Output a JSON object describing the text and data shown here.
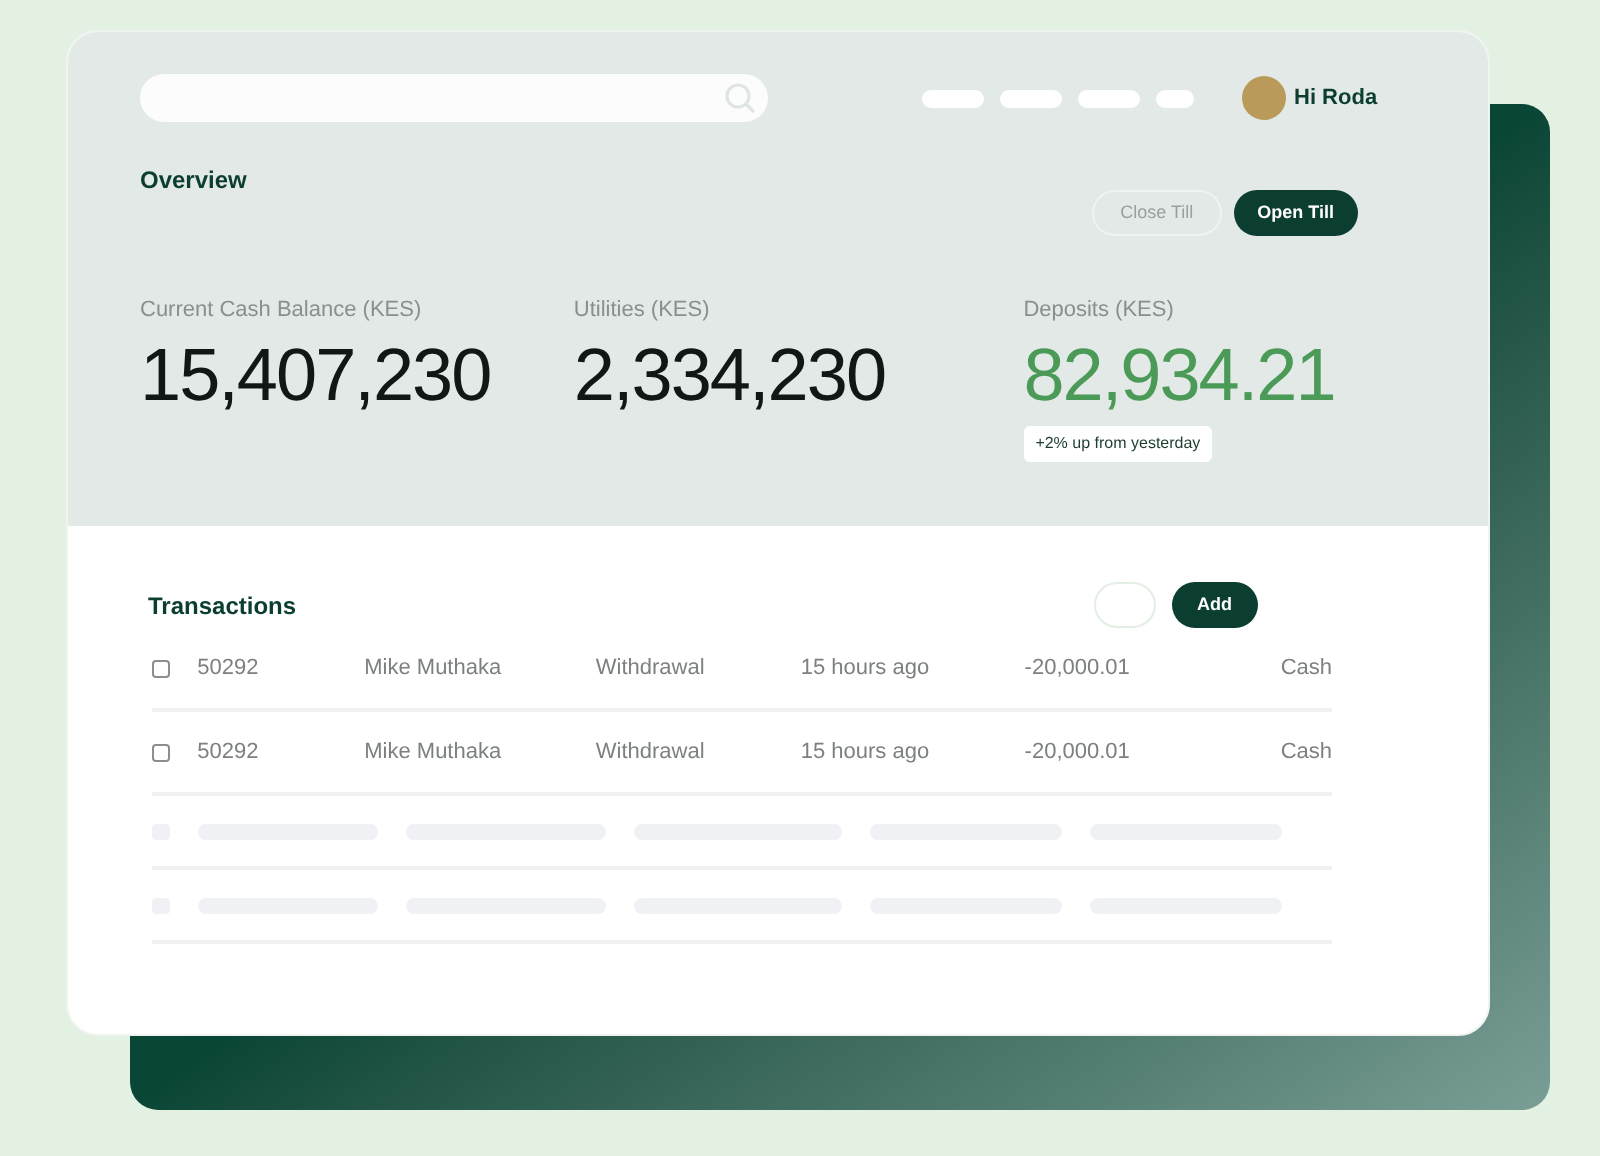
{
  "header": {
    "greeting": "Hi Roda"
  },
  "overview": {
    "title": "Overview",
    "buttons": [
      {
        "label": "Close Till",
        "kind": "secondary"
      },
      {
        "label": "Open Till",
        "kind": "primary"
      }
    ]
  },
  "stats": [
    {
      "label": "Current Cash Balance (KES)",
      "value": "15,407,230",
      "highlight": false
    },
    {
      "label": "Utilities (KES)",
      "value": "2,334,230",
      "highlight": false
    },
    {
      "label": "Deposits (KES)",
      "value": "82,934.21",
      "highlight": true,
      "note": "+2% up from yesterday"
    }
  ],
  "transactions": {
    "title": "Transactions",
    "add_button": "Add",
    "rows": [
      {
        "checked": false,
        "cells": [
          "50292",
          "Mike Muthaka",
          "Withdrawal",
          "15 hours ago",
          "-20,000.01",
          "Cash"
        ]
      },
      {
        "checked": false,
        "cells": [
          "50292",
          "Mike Muthaka",
          "Withdrawal",
          "15 hours ago",
          "-20,000.01",
          "Cash"
        ]
      }
    ]
  }
}
